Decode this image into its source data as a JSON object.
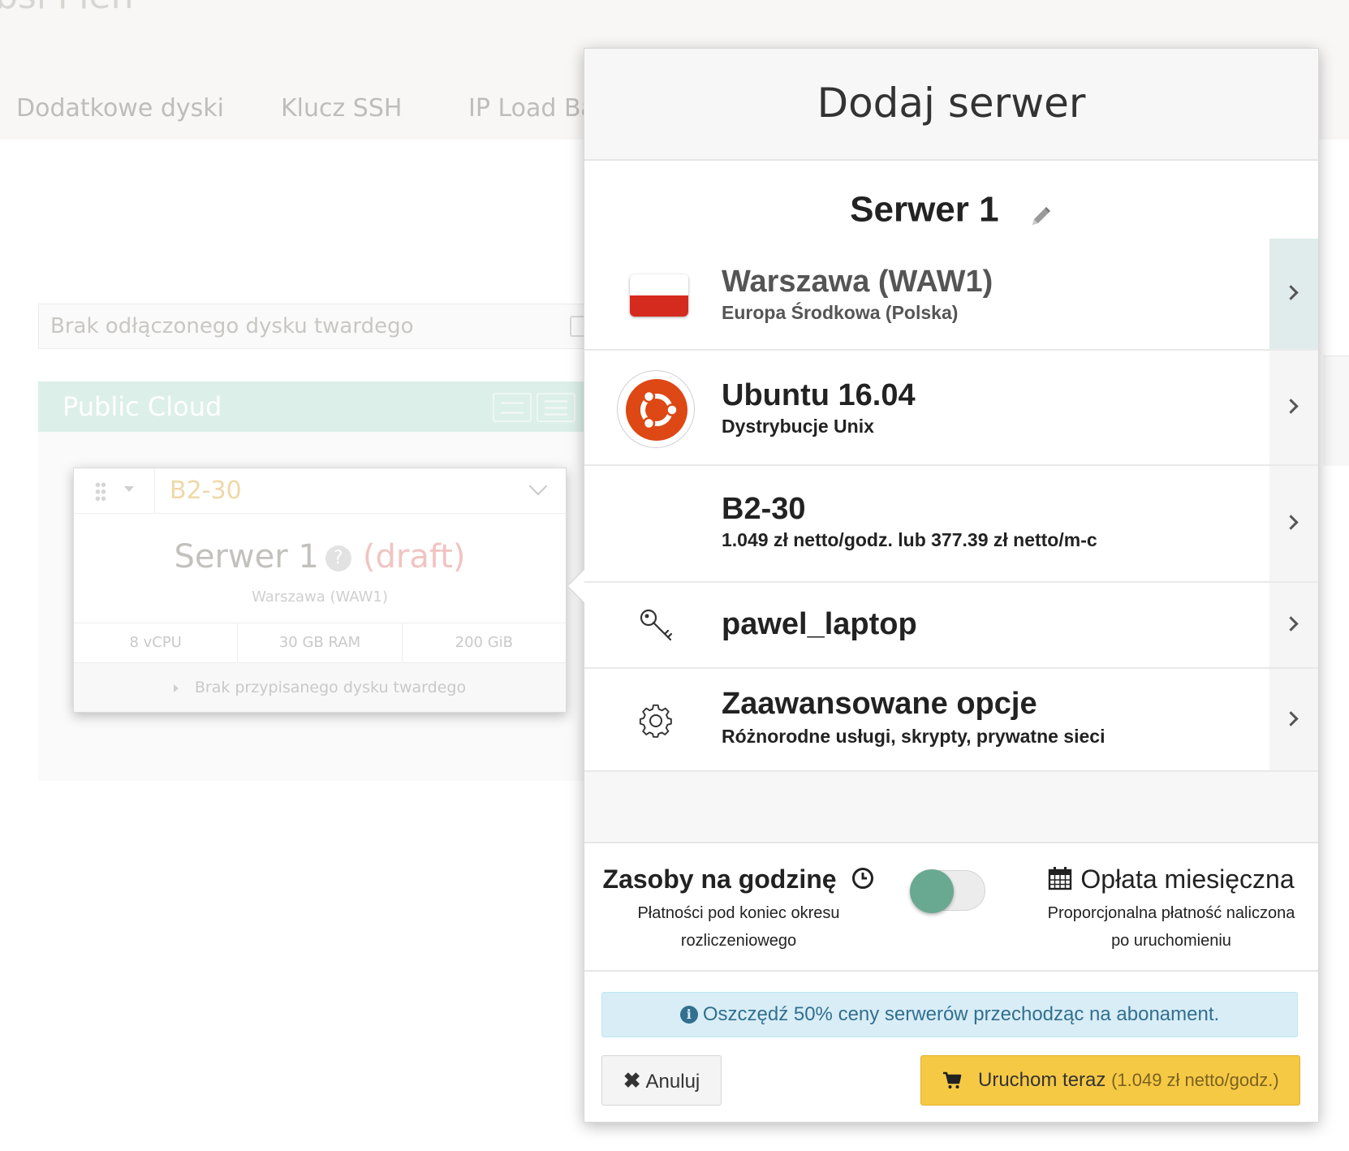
{
  "background": {
    "top_fragment": "bsi i ien",
    "tabs": [
      "Dodatkowe dyski",
      "Klucz SSH",
      "IP Load Ba"
    ],
    "detached_disk_placeholder": "Brak odłączonego dysku twardego",
    "section_title": "Public Cloud",
    "card": {
      "flavor": "B2-30",
      "server_name": "Serwer 1",
      "help_glyph": "?",
      "status": "(draft)",
      "location": "Warszawa (WAW1)",
      "specs": [
        "8 vCPU",
        "30 GB RAM",
        "200 GiB"
      ],
      "disk_note": "Brak przypisanego dysku twardego"
    }
  },
  "panel": {
    "title": "Dodaj serwer",
    "server_name": "Serwer 1",
    "options": [
      {
        "key": "region",
        "title": "Warszawa (WAW1)",
        "subtitle": "Europa Środkowa (Polska)",
        "icon": "poland-flag-icon"
      },
      {
        "key": "image",
        "title": "Ubuntu 16.04",
        "subtitle": "Dystrybucje Unix",
        "icon": "ubuntu-logo-icon"
      },
      {
        "key": "flavor",
        "title": "B2-30",
        "subtitle": "1.049 zł netto/godz. lub 377.39 zł netto/m-c",
        "icon": ""
      },
      {
        "key": "ssh",
        "title": "pawel_laptop",
        "subtitle": "",
        "icon": "key-icon"
      },
      {
        "key": "advanced",
        "title": "Zaawansowane opcje",
        "subtitle": "Różnorodne usługi, skrypty, prywatne sieci",
        "icon": "gear-icon"
      }
    ],
    "billing": {
      "hourly_title": "Zasoby na godzinę",
      "hourly_desc_line1": "Płatności pod koniec okresu",
      "hourly_desc_line2": "rozliczeniowego",
      "monthly_title": "Opłata miesięczna",
      "monthly_desc_line1": "Proporcjonalna płatność naliczona",
      "monthly_desc_line2": "po uruchomieniu",
      "selected": "hourly"
    },
    "info": "Oszczędź 50% ceny serwerów przechodząc na abonament.",
    "cancel_label": "Anuluj",
    "launch_label": "Uruchom teraz",
    "launch_price": "(1.049 zł netto/godz.)"
  },
  "colors": {
    "accent_toggle": "#6aa991",
    "launch_button": "#f6c945",
    "info_background": "#d9edf7",
    "flag_red": "#d52b1e",
    "ubuntu_orange": "#dd4814"
  }
}
